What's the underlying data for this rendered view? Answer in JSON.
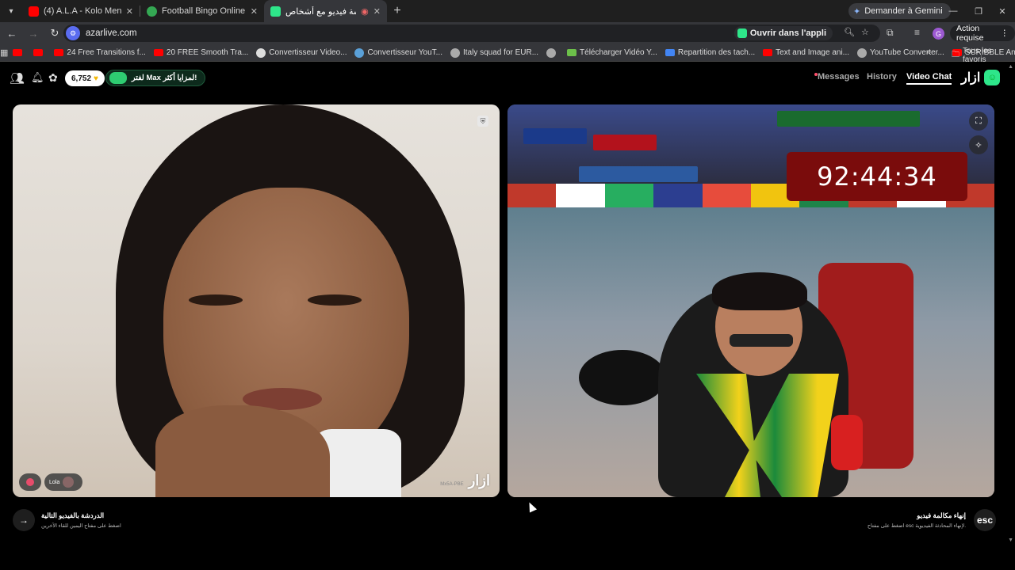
{
  "browser": {
    "tabs": [
      {
        "title": "(4) A.L.A - Kolo Meni (Official M",
        "favicon_color": "#ff0000",
        "active": false
      },
      {
        "title": "Football Bingo Online - Play No",
        "favicon_color": "#34a853",
        "active": false
      },
      {
        "title": "أزارددرشة فيديو مع أشخاص ·",
        "favicon_color": "#2ee68a",
        "active": true
      }
    ],
    "new_tab_label": "+",
    "gemini_label": "Demander à Gemini",
    "url": "azarlive.com",
    "open_app_label": "Ouvrir dans l'appli",
    "action_required_label": "Action requise",
    "profile_initial": "G",
    "bookmarks": [
      {
        "label": "",
        "icon_color": "#ff0000"
      },
      {
        "label": "",
        "icon_color": "#ff0000"
      },
      {
        "label": "24 Free Transitions f...",
        "icon_color": "#ff0000"
      },
      {
        "label": "20 FREE Smooth Tra...",
        "icon_color": "#ff0000"
      },
      {
        "label": "Convertisseur Video...",
        "icon_color": "#dddddd"
      },
      {
        "label": "Convertisseur YouT...",
        "icon_color": "#5aa0d8"
      },
      {
        "label": "Italy squad for EUR...",
        "icon_color": "#aaaaaa"
      },
      {
        "label": "",
        "icon_color": "#aaaaaa"
      },
      {
        "label": "Télécharger Vidéo Y...",
        "icon_color": "#6cc04a"
      },
      {
        "label": "Repartition des tach...",
        "icon_color": "#4285f4"
      },
      {
        "label": "Text and Image ani...",
        "icon_color": "#ff0000"
      },
      {
        "label": "YouTube Converter...",
        "icon_color": "#aaaaaa"
      },
      {
        "label": "SCRIBBLE Animatio...",
        "icon_color": "#ff0000"
      }
    ],
    "all_bookmarks_label": "Tous les favoris"
  },
  "app": {
    "coins": "6,752",
    "max_promo": "لفتر Max لمزايا أكثر!",
    "nav": {
      "messages": "Messages",
      "history": "History",
      "video_chat": "Video Chat"
    },
    "logo_text": "ازار",
    "left_video": {
      "watermark_id": "Mx5A-PBE",
      "watermark_logo": "ازار",
      "user_pill": "Lola"
    },
    "right_video": {
      "timer": "92:44:34"
    },
    "next_action": {
      "title": "الدردشة بالفيديو التالية",
      "subtitle": "اضغط على مفتاح اليمين للقاء الآخرين"
    },
    "end_action": {
      "key_label": "esc",
      "title": "إنهاء مكالمة فيديو",
      "subtitle": "اضغط على مفتاح esc لإنهاء المحادثة الفيديوية."
    }
  },
  "colors": {
    "accent_green": "#2ee68a",
    "timer_bg": "#7a0c0c",
    "messages_dot": "#ff4f6b"
  }
}
